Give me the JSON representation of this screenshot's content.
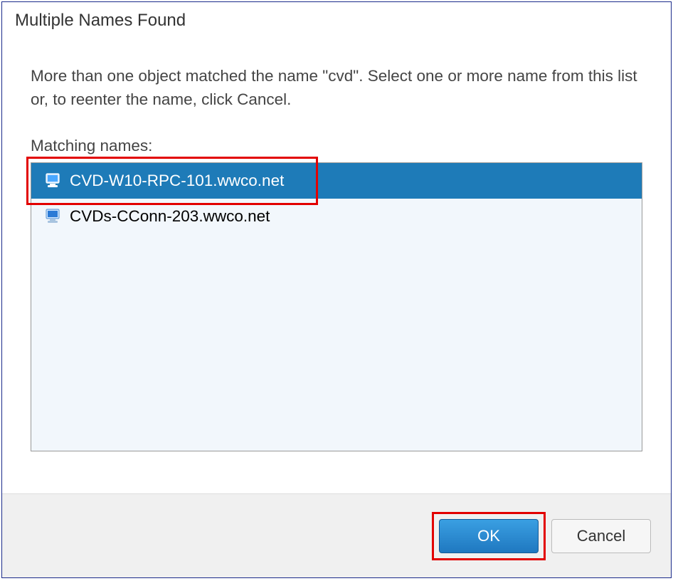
{
  "dialog": {
    "title": "Multiple Names Found",
    "message": "More than one object matched the name \"cvd\". Select one or more name from this list or, to reenter the name, click Cancel.",
    "list_label": "Matching names:",
    "items": [
      {
        "name": "CVD-W10-RPC-101.wwco.net",
        "selected": true
      },
      {
        "name": "CVDs-CConn-203.wwco.net",
        "selected": false
      }
    ],
    "buttons": {
      "ok": "OK",
      "cancel": "Cancel"
    }
  }
}
